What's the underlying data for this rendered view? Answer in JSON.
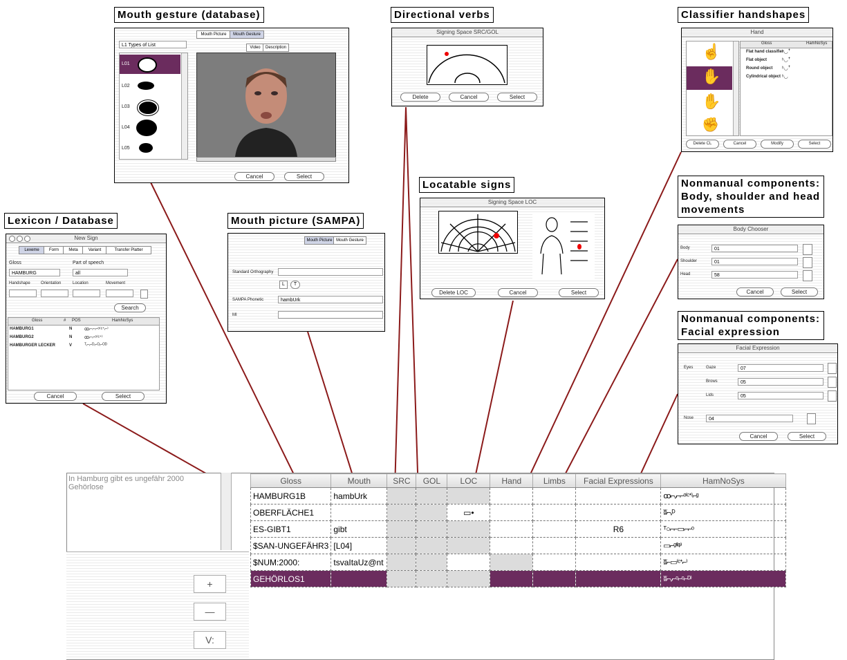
{
  "labels": {
    "mouth_gesture": "Mouth gesture (database)",
    "directional": "Directional verbs",
    "classifier": "Classifier handshapes",
    "locatable": "Locatable signs",
    "nonmanual_body": "Nonmanual components: Body, shoulder and head movements",
    "nonmanual_facial": "Nonmanual components: Facial expression",
    "lexicon": "Lexicon / Database",
    "mouth_picture": "Mouth picture (SAMPA)"
  },
  "mouth_gesture_win": {
    "tabs": [
      "Mouth Picture",
      "Mouth Gesture"
    ],
    "dropdown": "L1 Types of List",
    "subtabs": [
      "Video",
      "Description"
    ],
    "rows": [
      "L01",
      "L02",
      "L03",
      "L04",
      "L05"
    ],
    "cancel": "Cancel",
    "select": "Select"
  },
  "directional_win": {
    "title": "Signing Space SRC/GOL",
    "delete": "Delete",
    "cancel": "Cancel",
    "select": "Select"
  },
  "classifier_win": {
    "title": "Hand",
    "col1": "Gloss",
    "col2": "HamNoSys",
    "rows": [
      {
        "gloss": "Flat hand classifier",
        "ham": "ʰ◡ꜛ"
      },
      {
        "gloss": "Flat object",
        "ham": "ʰ◡ꜛ"
      },
      {
        "gloss": "Round object",
        "ham": "ʰ◡ꜛ"
      },
      {
        "gloss": "Cylindrical object",
        "ham": "ʰ◡"
      }
    ],
    "buttons": [
      "Delete CL",
      "Cancel",
      "Modify",
      "Select"
    ]
  },
  "locatable_win": {
    "title": "Signing Space LOC",
    "delete": "Delete LOC",
    "cancel": "Cancel",
    "select": "Select"
  },
  "body_win": {
    "title": "Body Chooser",
    "fields": [
      {
        "label": "Body",
        "value": "01"
      },
      {
        "label": "Shoulder",
        "value": "01"
      },
      {
        "label": "Head",
        "value": "58"
      }
    ],
    "cancel": "Cancel",
    "select": "Select"
  },
  "facial_win": {
    "title": "Facial Expression",
    "group": "Eyes",
    "fields": [
      {
        "label": "Gaze",
        "value": "07"
      },
      {
        "label": "Brows",
        "value": "05"
      },
      {
        "label": "Lids",
        "value": "05"
      }
    ],
    "nose_label": "Nose",
    "nose_value": "04",
    "cancel": "Cancel",
    "select": "Select"
  },
  "lexicon_win": {
    "title": "New Sign",
    "tabs": [
      "Lexeme",
      "Form",
      "Meta",
      "Variant",
      "Transfer Platter"
    ],
    "gloss_label": "Gloss",
    "gloss_value": "HAMBURG",
    "pos_label": "Part of speech",
    "pos_value": "all",
    "filters": [
      "Handshape",
      "Orientation",
      "Location",
      "Movement"
    ],
    "search": "Search",
    "cols": [
      "Gloss",
      "#",
      "POS",
      "HamNoSys"
    ],
    "rows": [
      {
        "gloss": "HAMBURG1",
        "num": "N",
        "ham": "ꝏ⌐⌐⌐ᵒ⁽ᶜᐩ⌐⁾"
      },
      {
        "gloss": "HAMBURG2",
        "num": "N",
        "ham": "ꝏ⌐⌐ᵒ⁽ᶜᐩ⁾"
      },
      {
        "gloss": "HAMBURGER LECKER",
        "num": "V",
        "ham": "ᵀ⌐⌐ᴰ⌐ᴼ⌐ᴼᴰ"
      }
    ],
    "cancel": "Cancel",
    "select": "Select"
  },
  "mouth_picture_win": {
    "tabs": [
      "Mouth Picture",
      "Mouth Gesture"
    ],
    "standard_label": "Standard Orthography",
    "sampa_label": "SAMPA Phonetic",
    "sampa_value": "hambUrk",
    "mi_label": "MI"
  },
  "main": {
    "text": "In Hamburg gibt es ungefähr 2000 Gehörlose",
    "buttons": [
      "+",
      "—",
      "V:"
    ],
    "columns": [
      "Gloss",
      "Mouth",
      "SRC",
      "GOL",
      "LOC",
      "Hand",
      "Limbs",
      "Facial Expressions",
      "HamNoSys"
    ],
    "rows": [
      {
        "gloss": "HAMBURG1B",
        "mouth": "hambUrk",
        "loc": "",
        "facial": "",
        "ham": "ꝏ⌐ᵥ⌐⌐ᵒ⁽ᶜᐩ⁾⌐ᵍ"
      },
      {
        "gloss": "OBERFLÄCHE1",
        "mouth": "",
        "loc": "▭•",
        "facial": "",
        "ham": "ʬ⌐ᵥᴰ"
      },
      {
        "gloss": "ES-GIBT1",
        "mouth": "gibt",
        "loc": "",
        "facial": "R6",
        "ham": "ᵀ○⌐⌐▭⌐⌐ᵒ"
      },
      {
        "gloss": "$SAN-UNGEFÄHR3",
        "mouth": "[L04]",
        "loc": "",
        "facial": "",
        "ham": "▭⌐ᵍ⁽ᴵᵠ⁾"
      },
      {
        "gloss": "$NUM:2000:",
        "mouth": "tsvaItaUz@nt",
        "loc": "",
        "facial": "",
        "ham": "ʬ⌐▭⁽ᶜᐩ⌐⁾"
      },
      {
        "gloss": "GEHÖRLOS1",
        "mouth": "",
        "loc": "",
        "facial": "",
        "ham": "ʬ⌐ᵥ⌐ᵒ⌐ᵒ⌐ᴰ⁾"
      }
    ]
  },
  "colors": {
    "accent": "#6b2c5e",
    "line": "#8b1a1a"
  }
}
